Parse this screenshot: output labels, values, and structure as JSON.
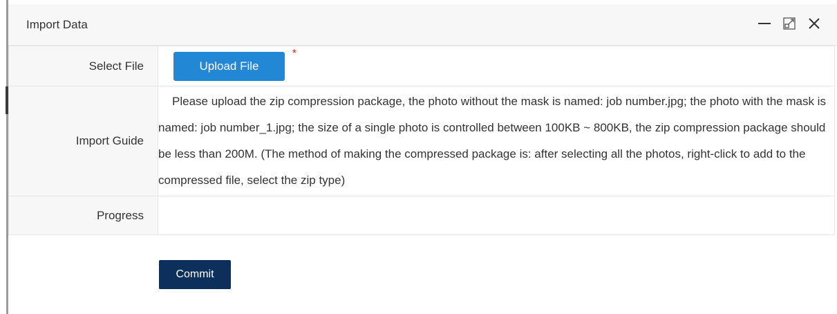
{
  "dialog": {
    "title": "Import Data",
    "controls": {
      "minimize_icon": "minimize-icon",
      "maximize_icon": "maximize-icon",
      "close_icon": "close-icon"
    }
  },
  "form": {
    "select_file": {
      "label": "Select File",
      "button_label": "Upload File",
      "required_mark": "*"
    },
    "import_guide": {
      "label": "Import Guide",
      "text": "Please upload the zip compression package, the photo without the mask is named: job number.jpg; the photo with the mask is named: job number_1.jpg; the size of a single photo is controlled between 100KB ~ 800KB, the zip compression package should be less than 200M. (The method of making the compressed package is: after selecting all the photos, right-click to add to the compressed file, select the zip type)"
    },
    "progress": {
      "label": "Progress",
      "value": ""
    }
  },
  "actions": {
    "commit_label": "Commit"
  },
  "colors": {
    "upload_button": "#2288d6",
    "commit_button": "#0c2f5c",
    "required_mark": "#e02020",
    "label_background": "#f7f7f7"
  }
}
